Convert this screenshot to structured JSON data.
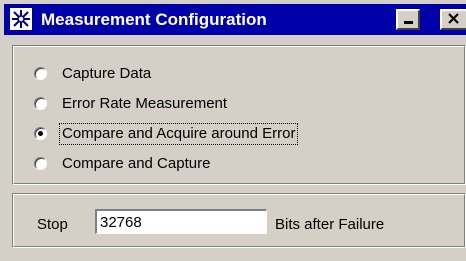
{
  "window": {
    "title": "Measurement Configuration",
    "icon": "app-icon",
    "controls": [
      "minimize-icon",
      "close-icon"
    ]
  },
  "measurement_mode": {
    "options": [
      {
        "label": "Capture Data",
        "checked": false
      },
      {
        "label": "Error Rate Measurement",
        "checked": false
      },
      {
        "label": "Compare and Acquire around Error",
        "checked": true
      },
      {
        "label": "Compare and Capture",
        "checked": false
      }
    ]
  },
  "stop": {
    "label": "Stop",
    "value": "32768",
    "suffix": "Bits after Failure"
  },
  "colors": {
    "titlebar": "#0000a8",
    "face": "#d4d0c8"
  }
}
